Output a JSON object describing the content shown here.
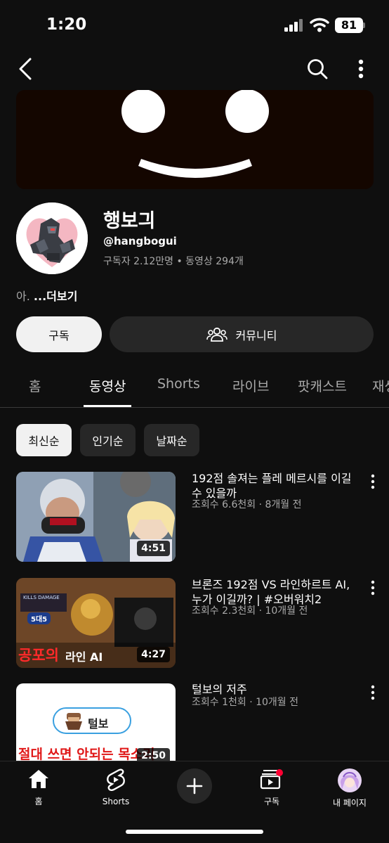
{
  "status_bar": {
    "time": "1:20",
    "battery": "81"
  },
  "channel": {
    "name": "행보긔",
    "handle": "@hangbogui",
    "stats": "구독자 2.12만명 • 동영상 294개",
    "description_prefix": "아. ",
    "description_more": "...더보기",
    "subscribe_label": "구독",
    "community_label": "커뮤니티"
  },
  "tabs": [
    {
      "label": "홈"
    },
    {
      "label": "동영상"
    },
    {
      "label": "Shorts"
    },
    {
      "label": "라이브"
    },
    {
      "label": "팟캐스트"
    },
    {
      "label": "재생"
    }
  ],
  "chips": [
    {
      "label": "최신순"
    },
    {
      "label": "인기순"
    },
    {
      "label": "날짜순"
    }
  ],
  "videos": [
    {
      "title": "192점 솔져는 플레 메르시를 이길수 있을까",
      "meta": "조회수 6.6천회 · 8개월 전",
      "duration": "4:51"
    },
    {
      "title": "브론즈 192점 VS 라인하르트 AI, 누가 이길까? | #오버워치2",
      "meta": "조회수 2.3천회 · 10개월 전",
      "duration": "4:27",
      "thumb_text_1": "공포의",
      "thumb_text_2": "라인 AI",
      "thumb_hud": "KILLS  DAMAGE",
      "thumb_badge": "5대5"
    },
    {
      "title": "털보의 저주",
      "meta": "조회수 1천회 · 10개월 전",
      "duration": "2:50",
      "thumb_pill": "털보",
      "thumb_caption": "절대 쓰면 안되는 목소리"
    }
  ],
  "bottom_nav": [
    {
      "label": "홈",
      "icon": "home-icon"
    },
    {
      "label": "Shorts",
      "icon": "shorts-icon"
    },
    {
      "label": "",
      "icon": "create-icon"
    },
    {
      "label": "구독",
      "icon": "subscriptions-icon"
    },
    {
      "label": "내 페이지",
      "icon": "profile-avatar"
    }
  ],
  "colors": {
    "background": "#0f0f0f",
    "chip": "#272727",
    "notification_dot": "#ff0033"
  }
}
